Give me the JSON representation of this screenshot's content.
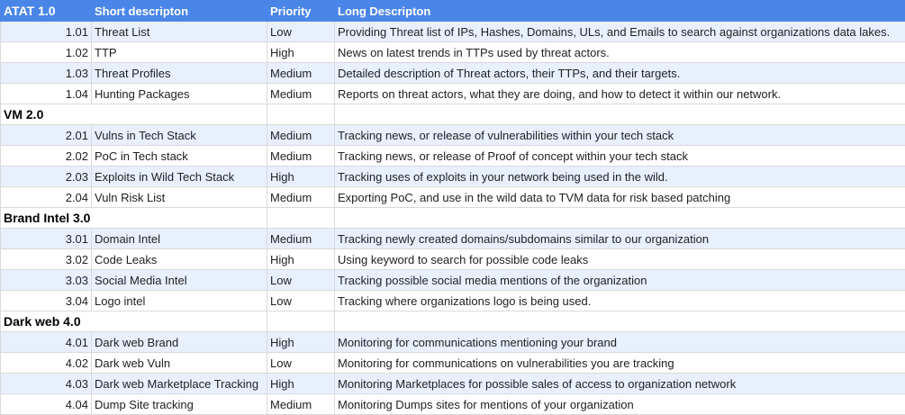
{
  "header": {
    "col0": "ATAT  1.0",
    "col1": "Short descripton",
    "col2": "Priority",
    "col3": "Long Descripton"
  },
  "rows": [
    {
      "id": "1.01",
      "short": "Threat List",
      "priority": "Low",
      "long": "Providing Threat list of IPs, Hashes, Domains, ULs, and Emails to search against organizations data lakes."
    },
    {
      "id": "1.02",
      "short": "TTP",
      "priority": "High",
      "long": "News on latest trends in TTPs used by threat actors."
    },
    {
      "id": "1.03",
      "short": "Threat Profiles",
      "priority": "Medium",
      "long": "Detailed description of Threat actors, their TTPs, and their targets."
    },
    {
      "id": "1.04",
      "short": "Hunting Packages",
      "priority": "Medium",
      "long": "Reports on threat actors, what they are doing, and how to detect it within our network."
    },
    {
      "section": "VM 2.0"
    },
    {
      "id": "2.01",
      "short": "Vulns in Tech Stack",
      "priority": "Medium",
      "long": "Tracking news, or release of vulnerabilities within your tech stack"
    },
    {
      "id": "2.02",
      "short": "PoC in Tech stack",
      "priority": "Medium",
      "long": "Tracking news, or release of Proof of concept within your tech stack"
    },
    {
      "id": "2.03",
      "short": "Exploits in Wild Tech Stack",
      "priority": "High",
      "long": "Tracking uses of exploits in your network being used in the wild."
    },
    {
      "id": "2.04",
      "short": "Vuln Risk List",
      "priority": "Medium",
      "long": "Exporting PoC, and use in the wild data to TVM data for risk based patching"
    },
    {
      "section": "Brand Intel 3.0"
    },
    {
      "id": "3.01",
      "short": "Domain Intel",
      "priority": "Medium",
      "long": "Tracking newly created domains/subdomains similar to our organization"
    },
    {
      "id": "3.02",
      "short": "Code Leaks",
      "priority": "High",
      "long": "Using keyword to search for possible code leaks"
    },
    {
      "id": "3.03",
      "short": "Social Media Intel",
      "priority": "Low",
      "long": "Tracking possible social media mentions of the organization"
    },
    {
      "id": "3.04",
      "short": "Logo intel",
      "priority": "Low",
      "long": "Tracking where organizations logo is being used."
    },
    {
      "section": "Dark web 4.0"
    },
    {
      "id": "4.01",
      "short": "Dark web Brand",
      "priority": "High",
      "long": "Monitoring for communications mentioning your brand"
    },
    {
      "id": "4.02",
      "short": "Dark web Vuln",
      "priority": "Low",
      "long": "Monitoring for communications on vulnerabilities you are tracking"
    },
    {
      "id": "4.03",
      "short": "Dark web Marketplace Tracking",
      "priority": "High",
      "long": "Monitoring Marketplaces for possible sales of access to organization  network"
    },
    {
      "id": "4.04",
      "short": "Dump Site tracking",
      "priority": "Medium",
      "long": "Monitoring Dumps sites for mentions of your organization"
    }
  ]
}
